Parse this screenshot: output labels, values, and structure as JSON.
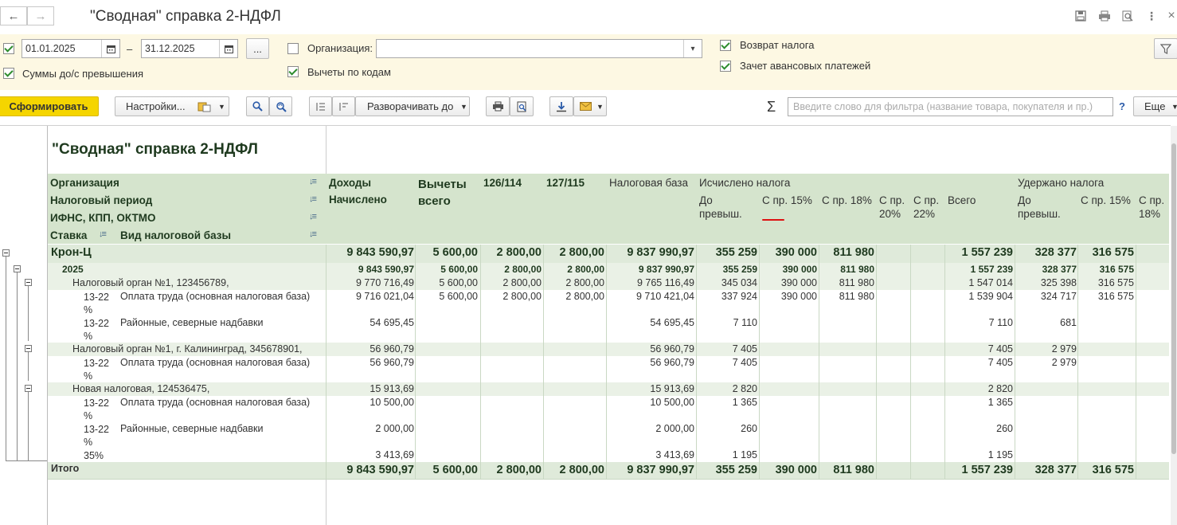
{
  "window": {
    "title": "\"Сводная\" справка 2-НДФЛ"
  },
  "settings": {
    "date_from": "01.01.2025",
    "date_dash": "–",
    "date_to": "31.12.2025",
    "dots": "...",
    "org_label": "Организация:",
    "org_value": "",
    "sums_label": "Суммы до/с превышения",
    "deductions_label": "Вычеты по кодам",
    "refund_label": "Возврат налога",
    "advance_label": "Зачет авансовых платежей"
  },
  "toolbar": {
    "generate": "Сформировать",
    "settings": "Настройки...",
    "expand": "Разворачивать до",
    "filter_placeholder": "Введите слово для фильтра (название товара, покупателя и пр.)",
    "help": "?",
    "more": "Еще",
    "sigma": "Σ"
  },
  "report": {
    "title": "\"Сводная\" справка 2-НДФЛ",
    "group_headers": [
      "Организация",
      "Налоговый период",
      "ИФНС, КПП, ОКТМО",
      "Ставка",
      "Вид налоговой базы"
    ],
    "col_income": "Доходы",
    "col_income_sub": "Начислено",
    "col_deductions": "Вычеты всего",
    "col_126": "126/114",
    "col_127": "127/115",
    "col_base": "Налоговая база",
    "col_calc": "Исчислено налога",
    "col_withheld": "Удержано налога",
    "sub_to": "До превыш.",
    "sub_15": "С пр. 15%",
    "sub_18": "С пр. 18%",
    "sub_20": "С пр. 20%",
    "sub_22": "С пр. 22%",
    "sub_total": "Всего",
    "w_to": "До превыш.",
    "w_15": "С пр. 15%",
    "w_18": "С пр. 18%",
    "rows": [
      {
        "level": 0,
        "a": "Крон-Ц",
        "b": "",
        "v": [
          "9 843 590,97",
          "5 600,00",
          "2 800,00",
          "2 800,00",
          "9 837 990,97",
          "355 259",
          "390 000",
          "811 980",
          "",
          "",
          "1 557 239",
          "328 377",
          "316 575",
          ""
        ]
      },
      {
        "level": 1,
        "a": "2025",
        "b": "",
        "v": [
          "9 843 590,97",
          "5 600,00",
          "2 800,00",
          "2 800,00",
          "9 837 990,97",
          "355 259",
          "390 000",
          "811 980",
          "",
          "",
          "1 557 239",
          "328 377",
          "316 575",
          ""
        ]
      },
      {
        "level": 2,
        "a": "Налоговый орган №1, 123456789,",
        "b": "",
        "v": [
          "9 770 716,49",
          "5 600,00",
          "2 800,00",
          "2 800,00",
          "9 765 116,49",
          "345 034",
          "390 000",
          "811 980",
          "",
          "",
          "1 547 014",
          "325 398",
          "316 575",
          ""
        ]
      },
      {
        "level": 3,
        "a": "13-22 %",
        "b": "Оплата труда (основная налоговая база)",
        "v": [
          "9 716 021,04",
          "5 600,00",
          "2 800,00",
          "2 800,00",
          "9 710 421,04",
          "337 924",
          "390 000",
          "811 980",
          "",
          "",
          "1 539 904",
          "324 717",
          "316 575",
          ""
        ]
      },
      {
        "level": 3,
        "a": "13-22 %",
        "b": "Районные, северные надбавки",
        "v": [
          "54 695,45",
          "",
          "",
          "",
          "54 695,45",
          "7 110",
          "",
          "",
          "",
          "",
          "7 110",
          "681",
          "",
          ""
        ]
      },
      {
        "level": 2,
        "a": "Налоговый орган №1, г. Калининград, 345678901,",
        "b": "",
        "v": [
          "56 960,79",
          "",
          "",
          "",
          "56 960,79",
          "7 405",
          "",
          "",
          "",
          "",
          "7 405",
          "2 979",
          "",
          ""
        ]
      },
      {
        "level": 3,
        "a": "13-22 %",
        "b": "Оплата труда (основная налоговая база)",
        "v": [
          "56 960,79",
          "",
          "",
          "",
          "56 960,79",
          "7 405",
          "",
          "",
          "",
          "",
          "7 405",
          "2 979",
          "",
          ""
        ]
      },
      {
        "level": 2,
        "a": "Новая налоговая, 124536475,",
        "b": "",
        "v": [
          "15 913,69",
          "",
          "",
          "",
          "15 913,69",
          "2 820",
          "",
          "",
          "",
          "",
          "2 820",
          "",
          "",
          ""
        ]
      },
      {
        "level": 3,
        "a": "13-22 %",
        "b": "Оплата труда (основная налоговая база)",
        "v": [
          "10 500,00",
          "",
          "",
          "",
          "10 500,00",
          "1 365",
          "",
          "",
          "",
          "",
          "1 365",
          "",
          "",
          ""
        ]
      },
      {
        "level": 3,
        "a": "13-22 %",
        "b": "Районные, северные надбавки",
        "v": [
          "2 000,00",
          "",
          "",
          "",
          "2 000,00",
          "260",
          "",
          "",
          "",
          "",
          "260",
          "",
          "",
          ""
        ]
      },
      {
        "level": 3,
        "a": "35%",
        "b": "",
        "v": [
          "3 413,69",
          "",
          "",
          "",
          "3 413,69",
          "1 195",
          "",
          "",
          "",
          "",
          "1 195",
          "",
          "",
          ""
        ]
      },
      {
        "level": 9,
        "a": "Итого",
        "b": "",
        "v": [
          "9 843 590,97",
          "5 600,00",
          "2 800,00",
          "2 800,00",
          "9 837 990,97",
          "355 259",
          "390 000",
          "811 980",
          "",
          "",
          "1 557 239",
          "328 377",
          "316 575",
          ""
        ]
      }
    ]
  },
  "colors": {
    "accent_yellow": "#f5d500",
    "header_green": "#d5e4cd",
    "strip": "#fdf8e3"
  }
}
